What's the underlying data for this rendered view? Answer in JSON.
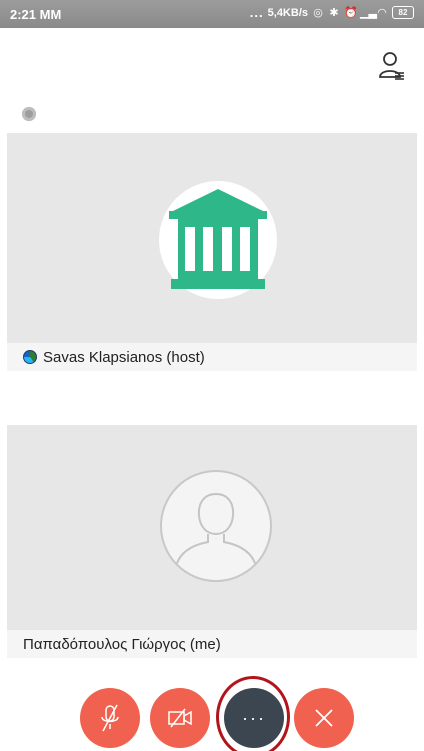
{
  "status_bar": {
    "time": "2:21 MM",
    "dots": "...",
    "network_speed": "5,4KB/s",
    "battery": "82"
  },
  "header": {
    "participants_icon": "participants-list-icon"
  },
  "participants": [
    {
      "name": "Savas Klapsianos (host)",
      "avatar_icon": "institution-icon",
      "avatar_color": "#2eb88a"
    },
    {
      "name": "Παπαδόπουλος Γιώργος (me)",
      "avatar_icon": "default-user-icon"
    }
  ],
  "controls": {
    "mute_icon": "microphone-off-icon",
    "video_icon": "video-camera-icon",
    "more_label": "···",
    "end_icon": "close-icon",
    "accent_color": "#f0614f",
    "more_color": "#3c4650",
    "highlight_color": "#b3141a"
  }
}
